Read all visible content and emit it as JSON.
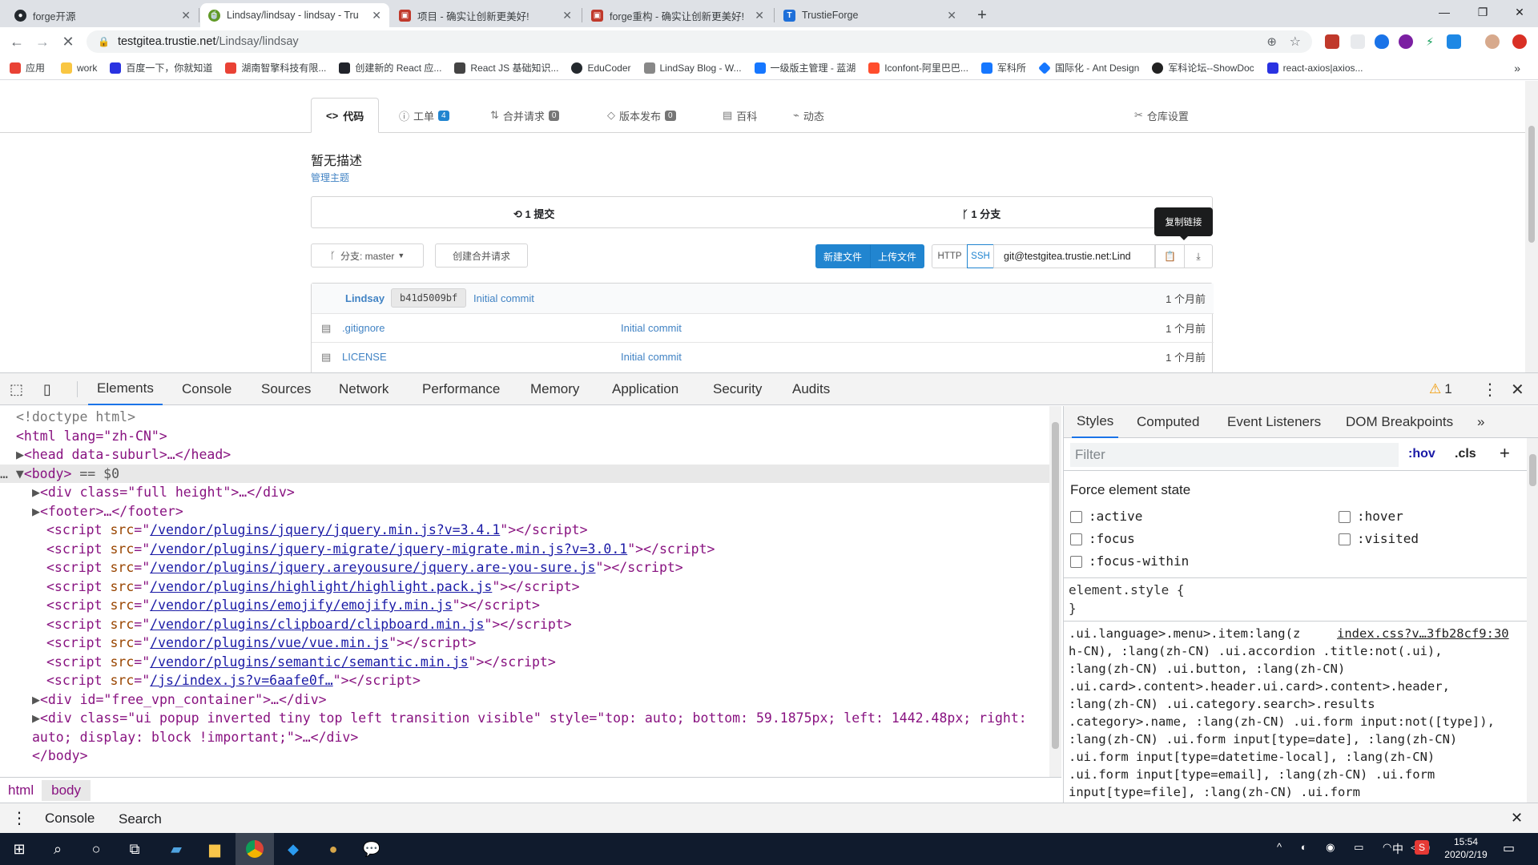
{
  "browser": {
    "tabs": [
      {
        "title": "forge开源",
        "favicon": "github-icon",
        "color": "#24292e"
      },
      {
        "title": "Lindsay/lindsay - lindsay - Tru",
        "favicon": "gitea-icon",
        "color": "#609926"
      },
      {
        "title": "项目 - 确实让创新更美好!",
        "favicon": "project-icon",
        "color": "#c0392b"
      },
      {
        "title": "forge重构 - 确实让创新更美好!",
        "favicon": "project-icon",
        "color": "#c0392b"
      },
      {
        "title": "TrustieForge",
        "favicon": "trustie-icon",
        "color": "#1e6fd9"
      }
    ],
    "url_host": "testgitea.trustie.net",
    "url_path": "/Lindsay/lindsay",
    "bookmarks": [
      {
        "label": "应用",
        "color": "#e94235"
      },
      {
        "label": "work",
        "color": "#f9c642"
      },
      {
        "label": "百度一下，你就知道",
        "color": "#2932e1"
      },
      {
        "label": "湖南智擎科技有限...",
        "color": "#e94235"
      },
      {
        "label": "创建新的 React 应...",
        "color": "#20232a"
      },
      {
        "label": "React JS 基础知识...",
        "color": "#444"
      },
      {
        "label": "EduCoder",
        "color": "#24292e"
      },
      {
        "label": "LindSay Blog - W...",
        "color": "#888"
      },
      {
        "label": "一级版主管理 - 蓝湖",
        "color": "#1677ff"
      },
      {
        "label": "Iconfont-阿里巴巴...",
        "color": "#ff4d2d"
      },
      {
        "label": "军科所",
        "color": "#1677ff"
      },
      {
        "label": "国际化 - Ant Design",
        "color": "#1677ff"
      },
      {
        "label": "军科论坛--ShowDoc",
        "color": "#222"
      },
      {
        "label": "react-axios|axios...",
        "color": "#2932e1"
      }
    ],
    "more_bookmarks": "»"
  },
  "repo": {
    "tabs": [
      {
        "label": "代码",
        "icon": "code-icon"
      },
      {
        "label": "工单",
        "icon": "issue-icon",
        "badge": "4"
      },
      {
        "label": "合并请求",
        "icon": "pull-request-icon",
        "badge": "0"
      },
      {
        "label": "版本发布",
        "icon": "tag-icon",
        "badge": "0"
      },
      {
        "label": "百科",
        "icon": "wiki-icon"
      },
      {
        "label": "动态",
        "icon": "activity-icon"
      }
    ],
    "settings_label": "仓库设置",
    "description": "暂无描述",
    "manage_topics": "管理主题",
    "commits": "1 提交",
    "branches": "1 分支",
    "branch_select": "分支: master",
    "create_pr": "创建合并请求",
    "new_file": "新建文件",
    "upload_file": "上传文件",
    "http": "HTTP",
    "ssh": "SSH",
    "clone_url": "git@testgitea.trustie.net:Lind",
    "copy_tooltip": "复制链接",
    "latest_commit": {
      "author": "Lindsay",
      "sha": "b41d5009bf",
      "message": "Initial commit",
      "time": "1 个月前"
    },
    "files": [
      {
        "name": ".gitignore",
        "message": "Initial commit",
        "time": "1 个月前"
      },
      {
        "name": "LICENSE",
        "message": "Initial commit",
        "time": "1 个月前"
      }
    ]
  },
  "devtools": {
    "tabs": [
      "Elements",
      "Console",
      "Sources",
      "Network",
      "Performance",
      "Memory",
      "Application",
      "Security",
      "Audits"
    ],
    "warnings": "1",
    "breadcrumbs": [
      "html",
      "body"
    ],
    "sidebar_tabs": [
      "Styles",
      "Computed",
      "Event Listeners",
      "DOM Breakpoints"
    ],
    "filter_placeholder": "Filter",
    "hov": ":hov",
    "cls": ".cls",
    "force_state_title": "Force element state",
    "states": [
      ":active",
      ":hover",
      ":focus",
      ":visited",
      ":focus-within"
    ],
    "element_style_open": "element.style {",
    "element_style_close": "}",
    "css_source": "index.css?v…3fb28cf9:30",
    "css_rules": [
      ".ui.language>.menu>.item:lang(z",
      "h-CN), :lang(zh-CN) .ui.accordion .title:not(.ui),",
      ":lang(zh-CN) .ui.button, :lang(zh-CN)",
      ".ui.card>.content>.header.ui.card>.content>.header,",
      ":lang(zh-CN) .ui.category.search>.results",
      ".category>.name, :lang(zh-CN) .ui.form input:not([type]),",
      ":lang(zh-CN) .ui.form input[type=date], :lang(zh-CN)",
      ".ui.form input[type=datetime-local], :lang(zh-CN)",
      ".ui.form input[type=email], :lang(zh-CN) .ui.form",
      "input[type=file], :lang(zh-CN) .ui.form"
    ],
    "drawer_tabs": [
      "Console",
      "Search"
    ],
    "dom": {
      "doctype": "<!doctype html>",
      "html_open": "<html lang=\"zh-CN\">",
      "head": "<head data-suburl>…</head>",
      "body": "<body>",
      "body_eq": " == $0",
      "div_full": "<div class=\"full height\">…</div>",
      "footer": "<footer>…</footer>",
      "scripts": [
        "/vendor/plugins/jquery/jquery.min.js?v=3.4.1",
        "/vendor/plugins/jquery-migrate/jquery-migrate.min.js?v=3.0.1",
        "/vendor/plugins/jquery.areyousure/jquery.are-you-sure.js",
        "/vendor/plugins/highlight/highlight.pack.js",
        "/vendor/plugins/emojify/emojify.min.js",
        "/vendor/plugins/clipboard/clipboard.min.js",
        "/vendor/plugins/vue/vue.min.js",
        "/vendor/plugins/semantic/semantic.min.js",
        "/js/index.js?v=6aafe0f…"
      ],
      "vpn_div": "<div id=\"free_vpn_container\">…</div>",
      "popup_div_1": "<div class=\"ui popup inverted tiny top left transition visible\" style=\"top: auto; bottom: 59.1875px; left: 1442.48px; right:",
      "popup_div_2": "auto; display: block !important;\">…</div>",
      "body_close": "</body>"
    }
  },
  "taskbar": {
    "time": "15:54",
    "date": "2020/2/19",
    "ime": "中"
  }
}
